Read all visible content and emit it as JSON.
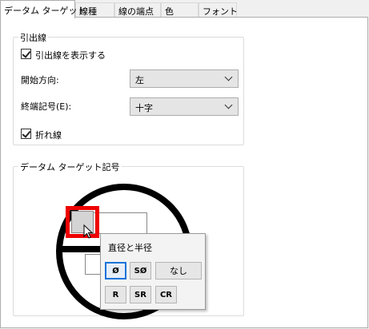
{
  "tabs": [
    {
      "label": "データム ターゲット"
    },
    {
      "label": "線種"
    },
    {
      "label": "線の端点"
    },
    {
      "label": "色"
    },
    {
      "label": "フォント"
    }
  ],
  "leader": {
    "group_title": "引出線",
    "show_checkbox_label": "引出線を表示する",
    "start_direction_label": "開始方向:",
    "start_direction_value": "左",
    "end_symbol_label": "終端記号(E):",
    "end_symbol_value": "十字",
    "bent_checkbox_label": "折れ線"
  },
  "datum_symbol": {
    "group_title": "データム ターゲット記号"
  },
  "popup": {
    "title": "直径と半径",
    "buttons": [
      {
        "label": "Ø"
      },
      {
        "label": "SØ"
      },
      {
        "label": "なし"
      },
      {
        "label": "R"
      },
      {
        "label": "SR"
      },
      {
        "label": "CR"
      }
    ]
  }
}
